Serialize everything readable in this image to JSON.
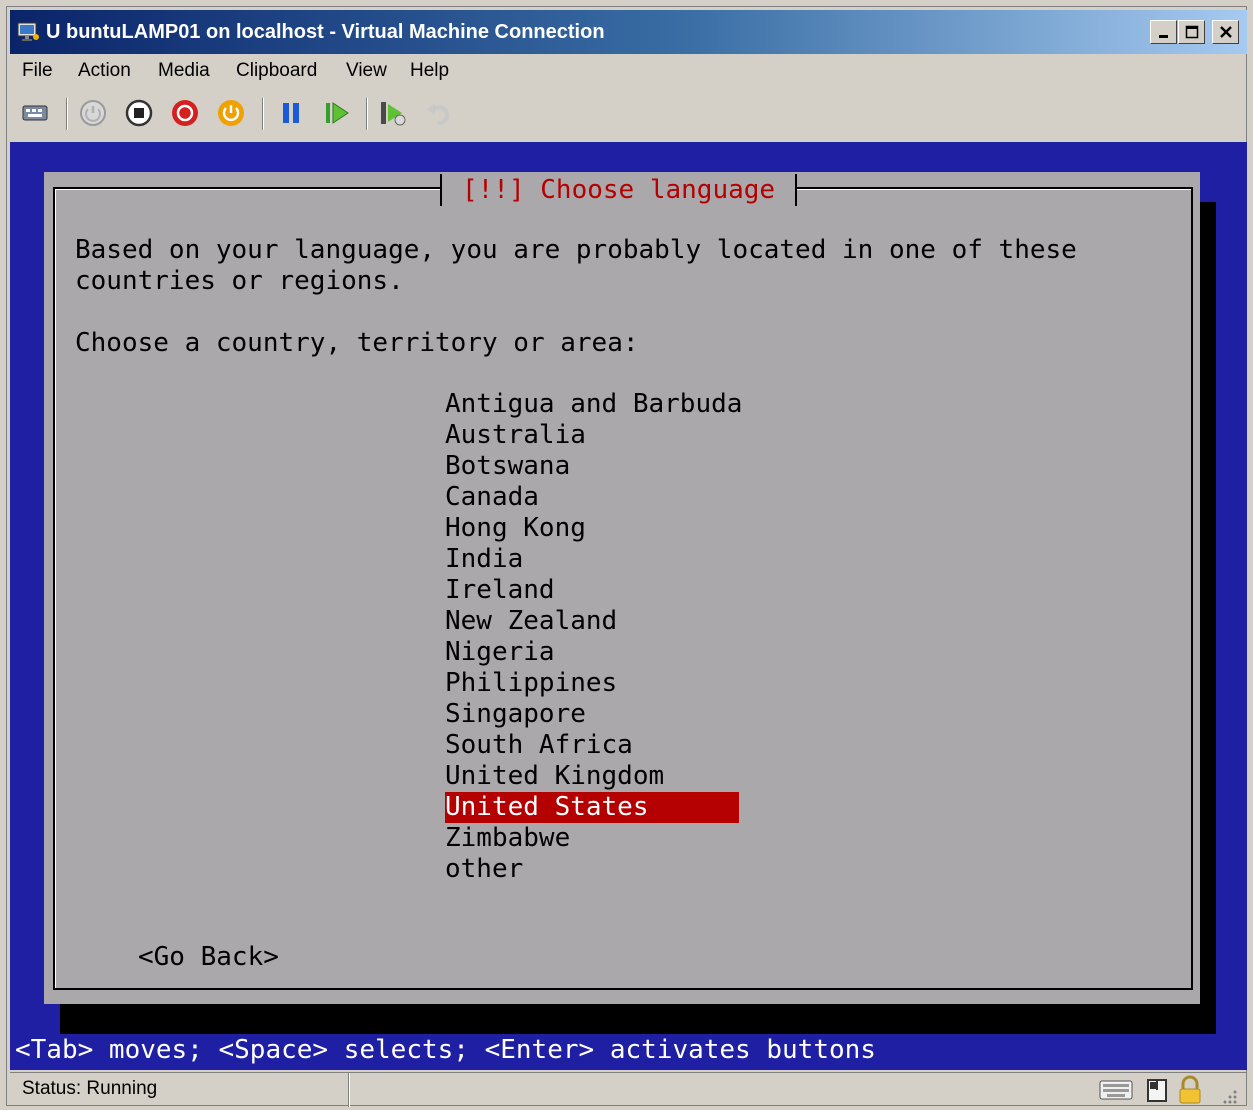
{
  "window": {
    "title": "U buntuLAMP01 on localhost - Virtual Machine Connection",
    "buttons": [
      "minimize-icon",
      "maximize-icon",
      "close-icon"
    ]
  },
  "menu": {
    "items": [
      "File",
      "Action",
      "Media",
      "Clipboard",
      "View",
      "Help"
    ]
  },
  "toolbar": {
    "icons": [
      "ctrl-alt-del-icon",
      "start-icon",
      "turn-off-icon",
      "shutdown-icon",
      "save-icon",
      "pause-icon",
      "resume-icon",
      "snapshot-icon",
      "revert-icon"
    ]
  },
  "console": {
    "dialog_title": "[!!] Choose language",
    "prompt_line1": "Based on your language, you are probably located in one of these",
    "prompt_line2": "countries or regions.",
    "prompt_question": "Choose a country, territory or area:",
    "options": [
      "Antigua and Barbuda",
      "Australia",
      "Botswana",
      "Canada",
      "Hong Kong",
      "India",
      "Ireland",
      "New Zealand",
      "Nigeria",
      "Philippines",
      "Singapore",
      "South Africa",
      "United Kingdom",
      "United States",
      "Zimbabwe",
      "other"
    ],
    "selected_option": "United States",
    "go_back": "<Go Back>",
    "help_line": "<Tab> moves; <Space> selects; <Enter> activates buttons"
  },
  "colors": {
    "console_bg": "#1f1fa3",
    "dialog_bg": "#aaa8aa",
    "accent_red": "#b40000"
  },
  "status": {
    "text": "Status: Running",
    "icons": [
      "keyboard-icon",
      "mouse-icon",
      "lock-icon"
    ]
  }
}
